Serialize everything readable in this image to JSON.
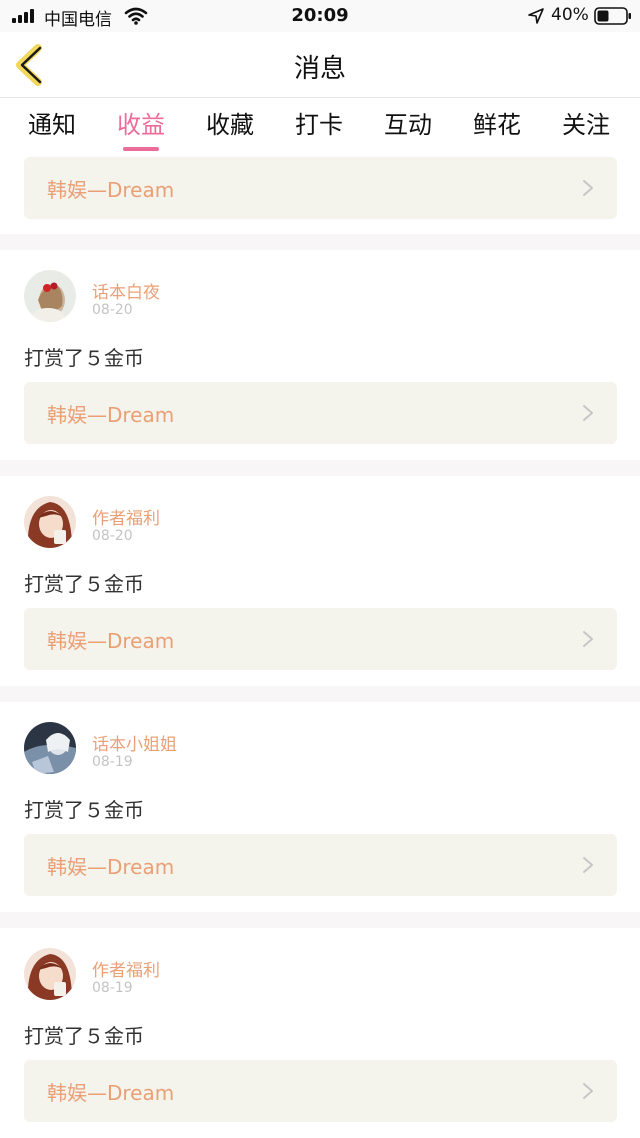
{
  "status_bar": {
    "carrier": "中国电信",
    "time": "20:09",
    "battery": "40%"
  },
  "header": {
    "title": "消息"
  },
  "tabs": [
    {
      "label": "通知",
      "active": false
    },
    {
      "label": "收益",
      "active": true
    },
    {
      "label": "收藏",
      "active": false
    },
    {
      "label": "打卡",
      "active": false
    },
    {
      "label": "互动",
      "active": false
    },
    {
      "label": "鲜花",
      "active": false
    },
    {
      "label": "关注",
      "active": false
    }
  ],
  "top_card": {
    "link_label": "韩娱—Dream"
  },
  "messages": [
    {
      "sender": "话本白夜",
      "date": "08-20",
      "text": "打赏了５金币",
      "link_label": "韩娱—Dream"
    },
    {
      "sender": "作者福利",
      "date": "08-20",
      "text": "打赏了５金币",
      "link_label": "韩娱—Dream"
    },
    {
      "sender": "话本小姐姐",
      "date": "08-19",
      "text": "打赏了５金币",
      "link_label": "韩娱—Dream"
    },
    {
      "sender": "作者福利",
      "date": "08-19",
      "text": "打赏了５金币",
      "link_label": "韩娱—Dream"
    }
  ],
  "colors": {
    "accent": "#ec6c99",
    "link_text": "#eaa076",
    "card_bg": "#f4f3ec",
    "back_icon": "#f1d85a"
  }
}
